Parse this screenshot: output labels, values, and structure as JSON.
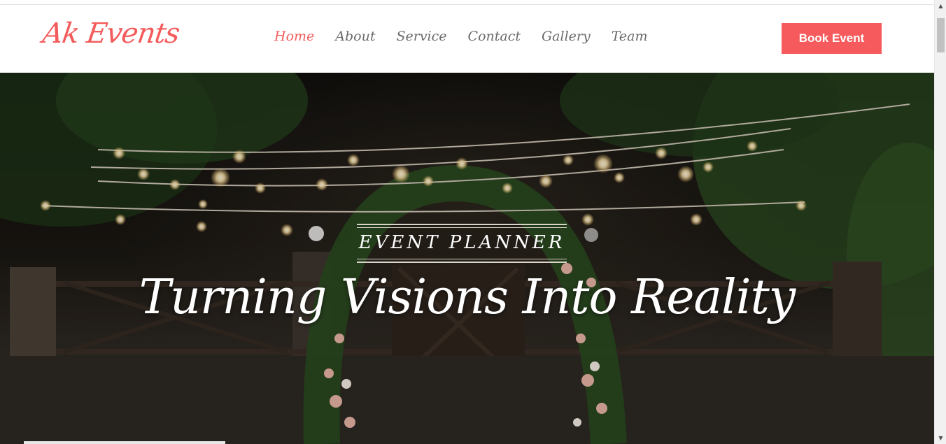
{
  "brand": {
    "logo_text": "Ak Events",
    "accent": "#f45b5b"
  },
  "nav": {
    "items": [
      {
        "label": "Home",
        "active": true
      },
      {
        "label": "About",
        "active": false
      },
      {
        "label": "Service",
        "active": false
      },
      {
        "label": "Contact",
        "active": false
      },
      {
        "label": "Gallery",
        "active": false
      },
      {
        "label": "Team",
        "active": false
      }
    ],
    "cta_label": "Book Event"
  },
  "hero": {
    "subtitle": "EVENT PLANNER",
    "headline": "Turning Visions Into Reality"
  },
  "icons": {
    "scroll_up": "triangle-up-icon",
    "scroll_down": "triangle-down-icon"
  }
}
